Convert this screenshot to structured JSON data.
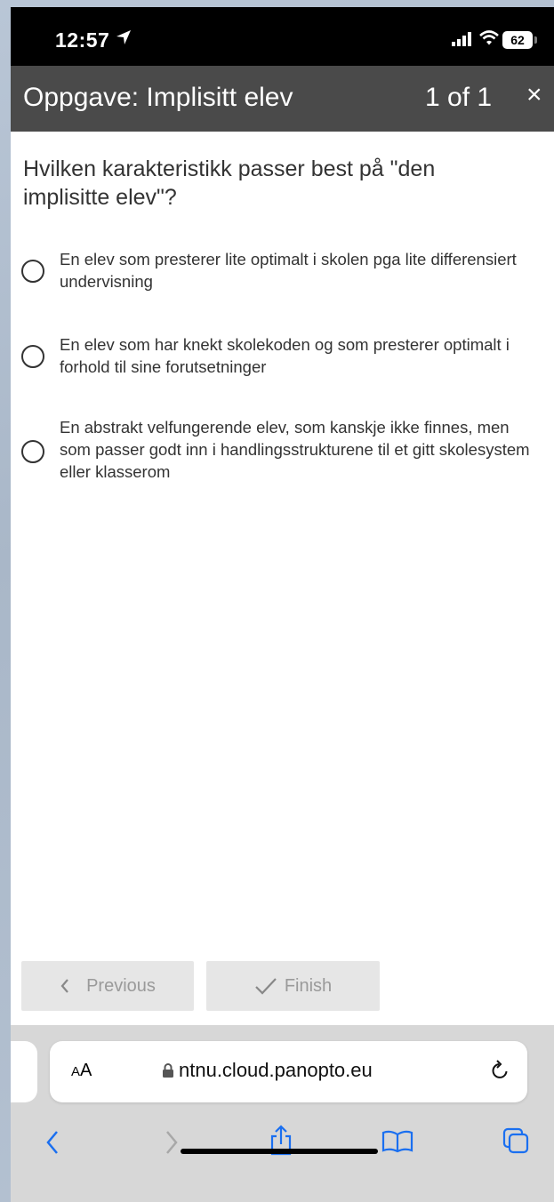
{
  "status_bar": {
    "time": "12:57",
    "battery": "62"
  },
  "header": {
    "title": "Oppgave: Implisitt elev",
    "counter": "1 of 1",
    "close": "×"
  },
  "question": "Hvilken karakteristikk passer best på \"den implisitte elev\"?",
  "options": [
    {
      "text": "En elev som presterer lite optimalt i skolen pga lite differensiert undervisning"
    },
    {
      "text": "En elev som har knekt skolekoden og som presterer optimalt i forhold til sine forutsetninger"
    },
    {
      "text": "En abstrakt velfungerende elev, som kanskje ikke finnes, men som passer godt inn i handlingsstrukturene til et gitt skolesystem eller klasserom"
    }
  ],
  "buttons": {
    "previous": "Previous",
    "finish": "Finish"
  },
  "browser": {
    "aa_small": "A",
    "aa_large": "A",
    "url": "ntnu.cloud.panopto.eu"
  },
  "icons": [
    "location-arrow-icon",
    "signal-icon",
    "wifi-icon",
    "battery-icon",
    "close-icon",
    "radio-icon",
    "chevron-left-icon",
    "checkmark-icon",
    "lock-icon",
    "reload-icon",
    "back-icon",
    "forward-icon",
    "share-icon",
    "bookmarks-icon",
    "tabs-icon"
  ],
  "colors": {
    "title_bar": "#4a4a4a",
    "button_bg": "#e6e6e6",
    "button_text": "#9a9a9a",
    "safari_accent": "#1a6ff0"
  }
}
